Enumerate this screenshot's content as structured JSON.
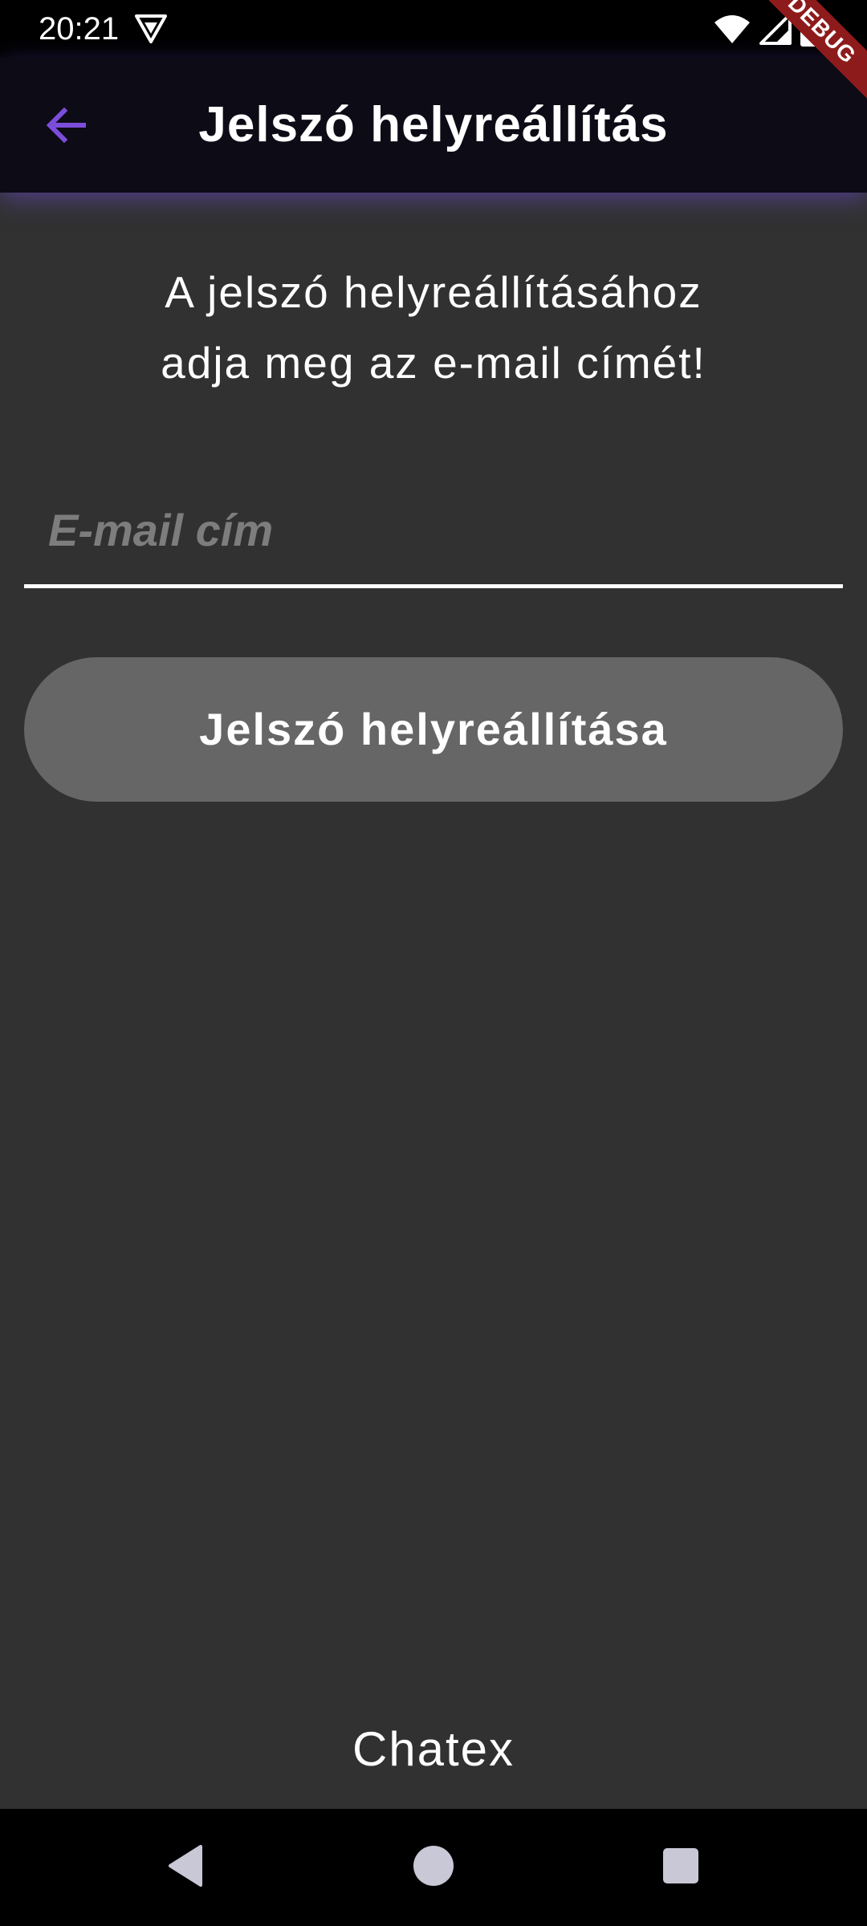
{
  "status_bar": {
    "time": "20:21",
    "left_icon": "vpn-shield-icon",
    "right_icons": [
      "wifi-icon",
      "signal-icon",
      "battery-icon"
    ]
  },
  "debug_banner": "DEBUG",
  "app_bar": {
    "back_icon": "arrow-back-icon",
    "title": "Jelszó helyreállítás",
    "accent_color": "#7c4ddb",
    "background_color": "#0d0b16"
  },
  "main": {
    "instruction": "A jelszó helyreállításához\nadja meg az e-mail címét!",
    "email_field": {
      "value": "",
      "placeholder": "E-mail cím"
    },
    "reset_button_label": "Jelszó helyreállítása",
    "background_color": "#313131"
  },
  "footer": {
    "brand": "Chatex"
  },
  "nav_bar": {
    "buttons": [
      "back-triangle-icon",
      "home-circle-icon",
      "recents-square-icon"
    ],
    "icon_color": "#c9c8d6"
  }
}
